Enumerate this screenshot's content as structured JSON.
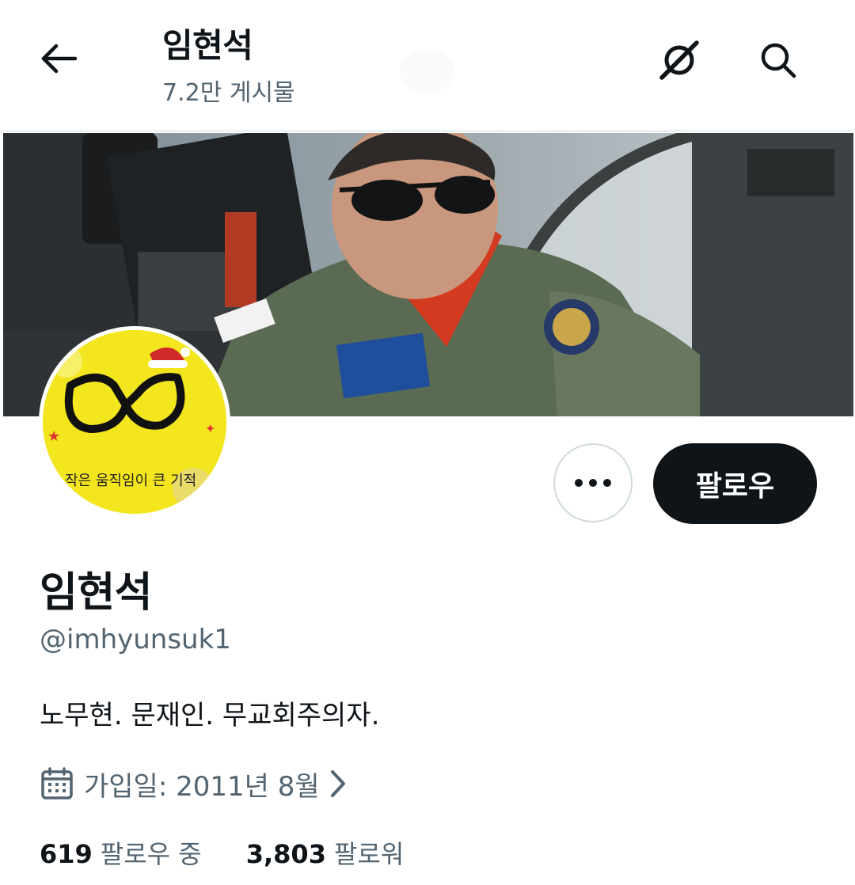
{
  "header": {
    "title": "임현석",
    "post_count": "7.2만 게시물",
    "back_icon": "arrow-left-icon",
    "grok_icon": "grok-icon",
    "search_icon": "search-icon"
  },
  "profile": {
    "avatar_text": "작은 움직임이 큰 기적",
    "display_name": "임현석",
    "handle": "@imhyunsuk1",
    "bio": "노무현. 문재인. 무교회주의자.",
    "joined": "가입일: 2011년 8월",
    "joined_icon": "calendar-icon"
  },
  "actions": {
    "follow_label": "팔로우",
    "more_icon": "more-horizontal-icon"
  },
  "stats": {
    "following_count": "619",
    "following_label": "팔로우 중",
    "followers_count": "3,803",
    "followers_label": "팔로워"
  },
  "colors": {
    "text_primary": "#0f1419",
    "text_secondary": "#536471",
    "follow_button_bg": "#0f1419",
    "avatar_bg": "#f3e51e"
  }
}
